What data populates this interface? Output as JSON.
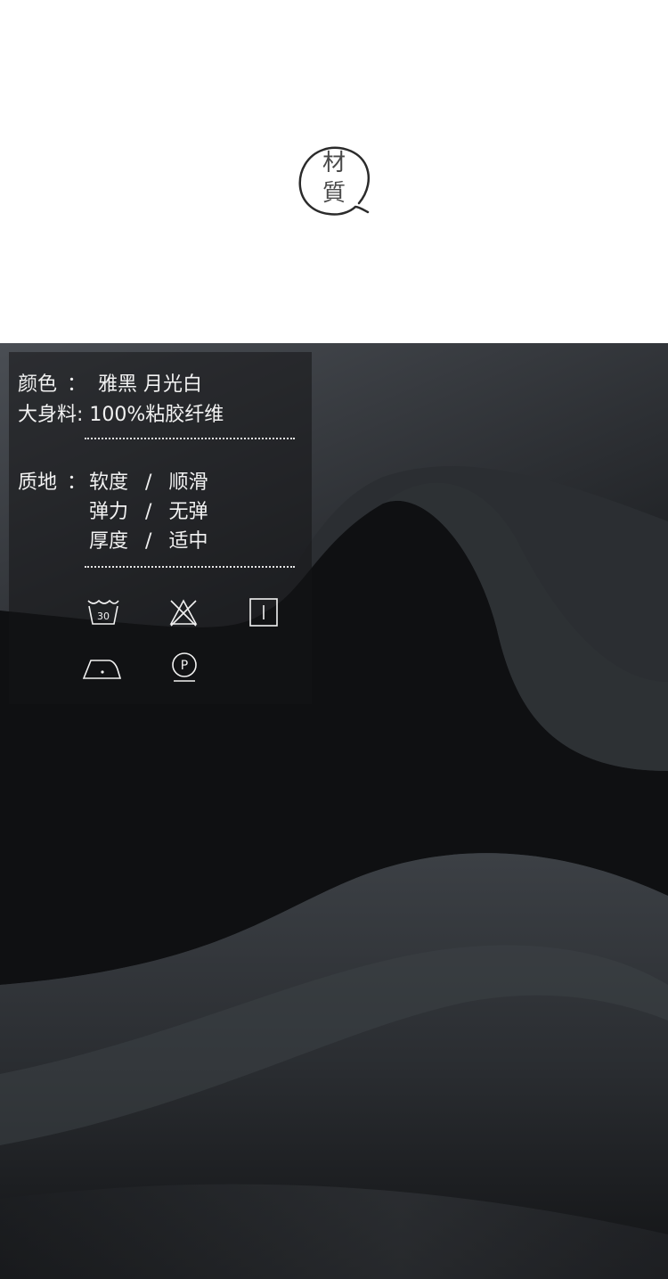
{
  "header": {
    "seal_line1": "材",
    "seal_line2": "質"
  },
  "specs": {
    "color_label": "颜色",
    "colon": "：",
    "color_values": "雅黑 月光白",
    "fabric_line": "大身料: 100%粘胶纤维",
    "texture_label": "质地",
    "texture_rows": [
      {
        "left": "软度",
        "sep": "/",
        "right": "顺滑"
      },
      {
        "left": "弹力",
        "sep": "/",
        "right": "无弹"
      },
      {
        "left": "厚度",
        "sep": "/",
        "right": "适中"
      }
    ]
  },
  "care_icons": {
    "wash_temp": "30",
    "dry_clean_letter": "P",
    "names": [
      "wash-30-icon",
      "no-bleach-icon",
      "line-dry-icon",
      "iron-low-icon",
      "dry-clean-p-icon"
    ]
  },
  "colors": {
    "text": "#f2f2f2",
    "panel": "rgba(20,20,22,0.55)",
    "fabric_dark": "#0d0e10"
  }
}
